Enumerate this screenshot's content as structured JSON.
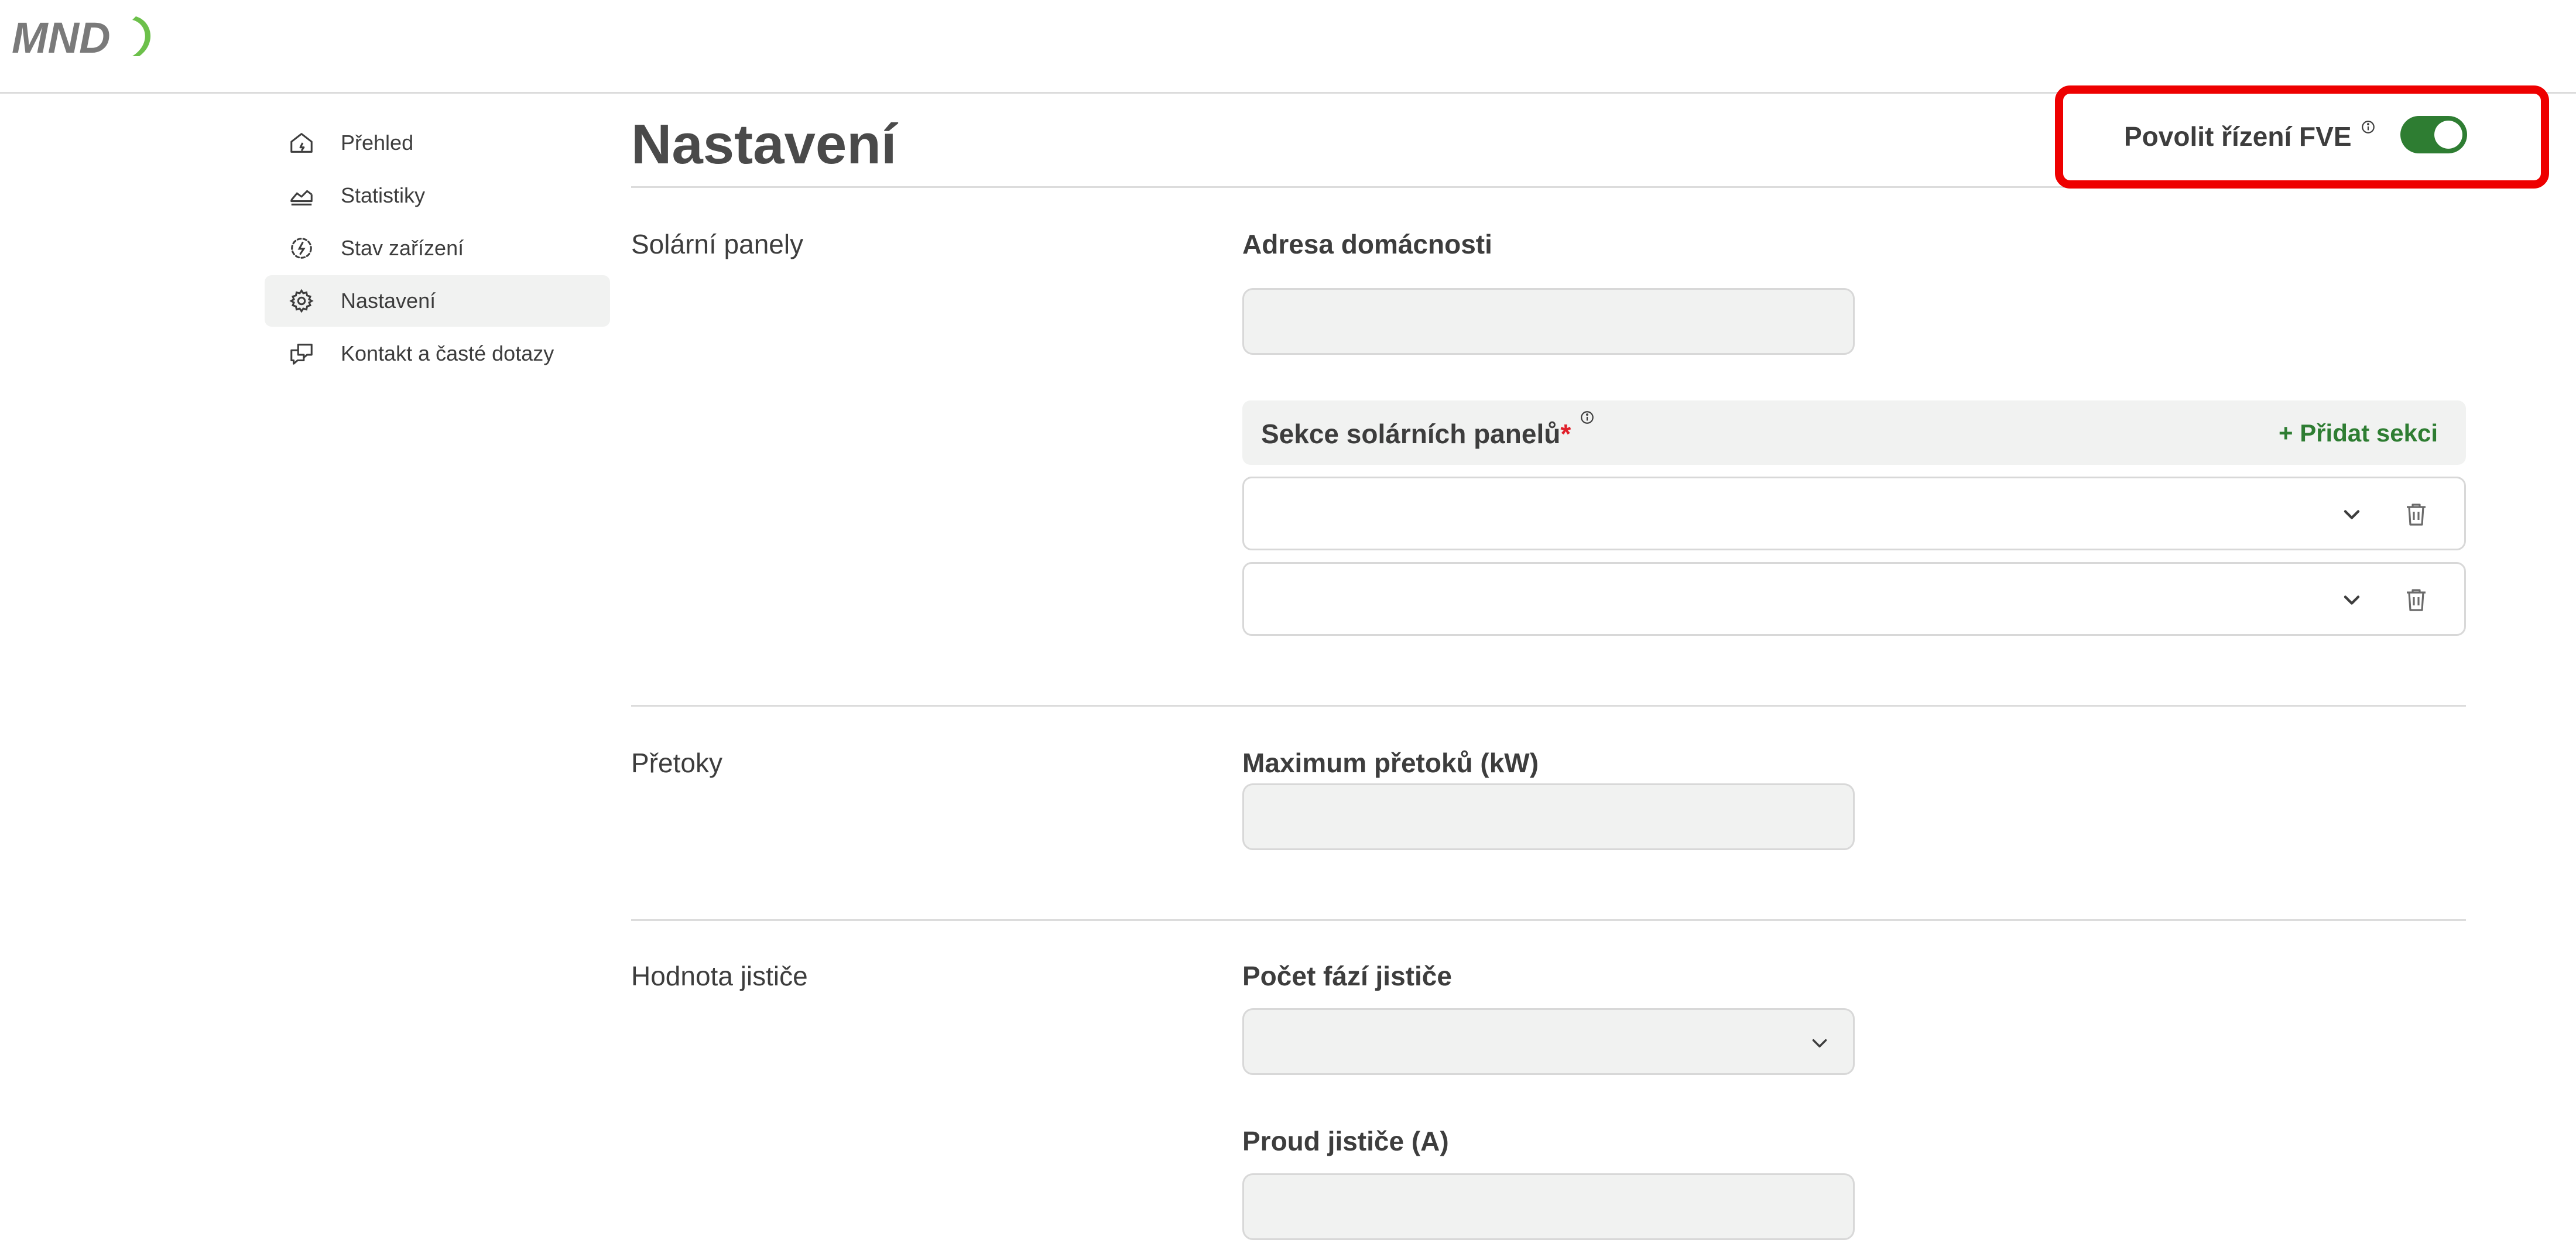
{
  "header": {
    "logo_text": "MND",
    "colors": {
      "logo_gray": "#7a7a7a",
      "logo_green": "#6cc04a"
    }
  },
  "sidebar": {
    "items": [
      {
        "label": "Přehled",
        "icon": "home-icon",
        "active": false
      },
      {
        "label": "Statistiky",
        "icon": "chart-icon",
        "active": false
      },
      {
        "label": "Stav zařízení",
        "icon": "device-status-icon",
        "active": false
      },
      {
        "label": "Nastavení",
        "icon": "gear-icon",
        "active": true
      },
      {
        "label": "Kontakt a časté dotazy",
        "icon": "chat-icon",
        "active": false
      }
    ]
  },
  "main": {
    "title": "Nastavení",
    "fve_toggle": {
      "label": "Povolit řízení FVE",
      "info_icon": "info-icon",
      "enabled": true,
      "color": "#2e7d32",
      "highlight_color": "#ee0000"
    },
    "solar": {
      "section_label": "Solární panely",
      "address_label": "Adresa domácnosti",
      "address_value": "",
      "panels_label": "Sekce solárních panelů",
      "required_mark": "*",
      "add_section_label": "+ Přidat sekci",
      "rows": [
        {
          "value": "",
          "chevron_icon": "chevron-down-icon",
          "delete_icon": "trash-icon"
        },
        {
          "value": "",
          "chevron_icon": "chevron-down-icon",
          "delete_icon": "trash-icon"
        }
      ]
    },
    "overflows": {
      "section_label": "Přetoky",
      "max_label": "Maximum přetoků (kW)",
      "max_value": ""
    },
    "breaker": {
      "section_label": "Hodnota jističe",
      "phases_label": "Počet fází jističe",
      "phases_value": "",
      "current_label": "Proud jističe (A)",
      "current_value": ""
    }
  }
}
